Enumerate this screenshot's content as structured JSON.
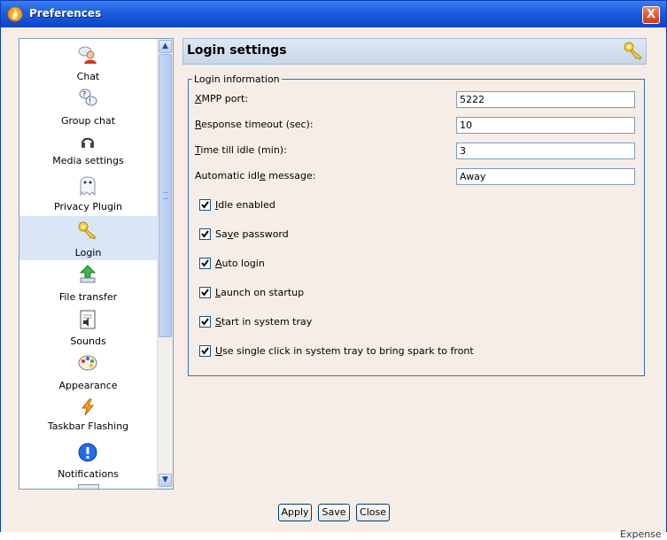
{
  "window": {
    "title": "Preferences",
    "close_glyph": "X",
    "icons": {
      "app": "spark-flame-icon",
      "close": "close-icon"
    }
  },
  "sidebar": {
    "items": [
      {
        "label": "Chat",
        "icon": "chat-person-icon",
        "selected": false
      },
      {
        "label": "Group chat",
        "icon": "group-chat-icon",
        "selected": false
      },
      {
        "label": "Media settings",
        "icon": "headset-icon",
        "selected": false
      },
      {
        "label": "Privacy Plugin",
        "icon": "ghost-icon",
        "selected": false
      },
      {
        "label": "Login",
        "icon": "key-icon",
        "selected": true
      },
      {
        "label": "File transfer",
        "icon": "file-transfer-icon",
        "selected": false
      },
      {
        "label": "Sounds",
        "icon": "sound-doc-icon",
        "selected": false
      },
      {
        "label": "Appearance",
        "icon": "palette-icon",
        "selected": false
      },
      {
        "label": "Taskbar Flashing",
        "icon": "lightning-icon",
        "selected": false
      },
      {
        "label": "Notifications",
        "icon": "info-icon",
        "selected": false
      }
    ],
    "scroll_up_glyph": "▲",
    "scroll_down_glyph": "▼"
  },
  "main": {
    "header_title": "Login settings",
    "header_icon": "keys-icon",
    "group_title": "Login information",
    "fields": [
      {
        "label": "XMPP port:",
        "mnemonic": "X",
        "rest": "MPP port:",
        "value": "5222"
      },
      {
        "label": "Response timeout (sec):",
        "mnemonic": "R",
        "rest": "esponse timeout (sec):",
        "value": "10"
      },
      {
        "label": "Time till idle (min):",
        "mnemonic": "T",
        "rest": "ime till idle (min):",
        "value": "3"
      },
      {
        "label": "Automatic idle message:",
        "pre": "Automatic idl",
        "mnemonic": "e",
        "rest": " message:",
        "value": "Away"
      }
    ],
    "checkboxes": [
      {
        "pre": "",
        "mnemonic": "I",
        "rest": "dle enabled",
        "checked": true
      },
      {
        "pre": "Sa",
        "mnemonic": "v",
        "rest": "e password",
        "checked": true
      },
      {
        "pre": "",
        "mnemonic": "A",
        "rest": "uto login",
        "checked": true
      },
      {
        "pre": "",
        "mnemonic": "L",
        "rest": "aunch on startup",
        "checked": true
      },
      {
        "pre": "",
        "mnemonic": "S",
        "rest": "tart in system tray",
        "checked": true
      },
      {
        "pre": "",
        "mnemonic": "U",
        "rest": "se single click in system tray to bring spark to front",
        "checked": true
      }
    ]
  },
  "footer": {
    "apply": "Apply",
    "save": "Save",
    "close": "Close"
  },
  "background_fragment": "Expense",
  "colors": {
    "titlebar": "#0b45c8",
    "selected_item": "#d8e6f8",
    "group_border": "#3a6fb0"
  }
}
